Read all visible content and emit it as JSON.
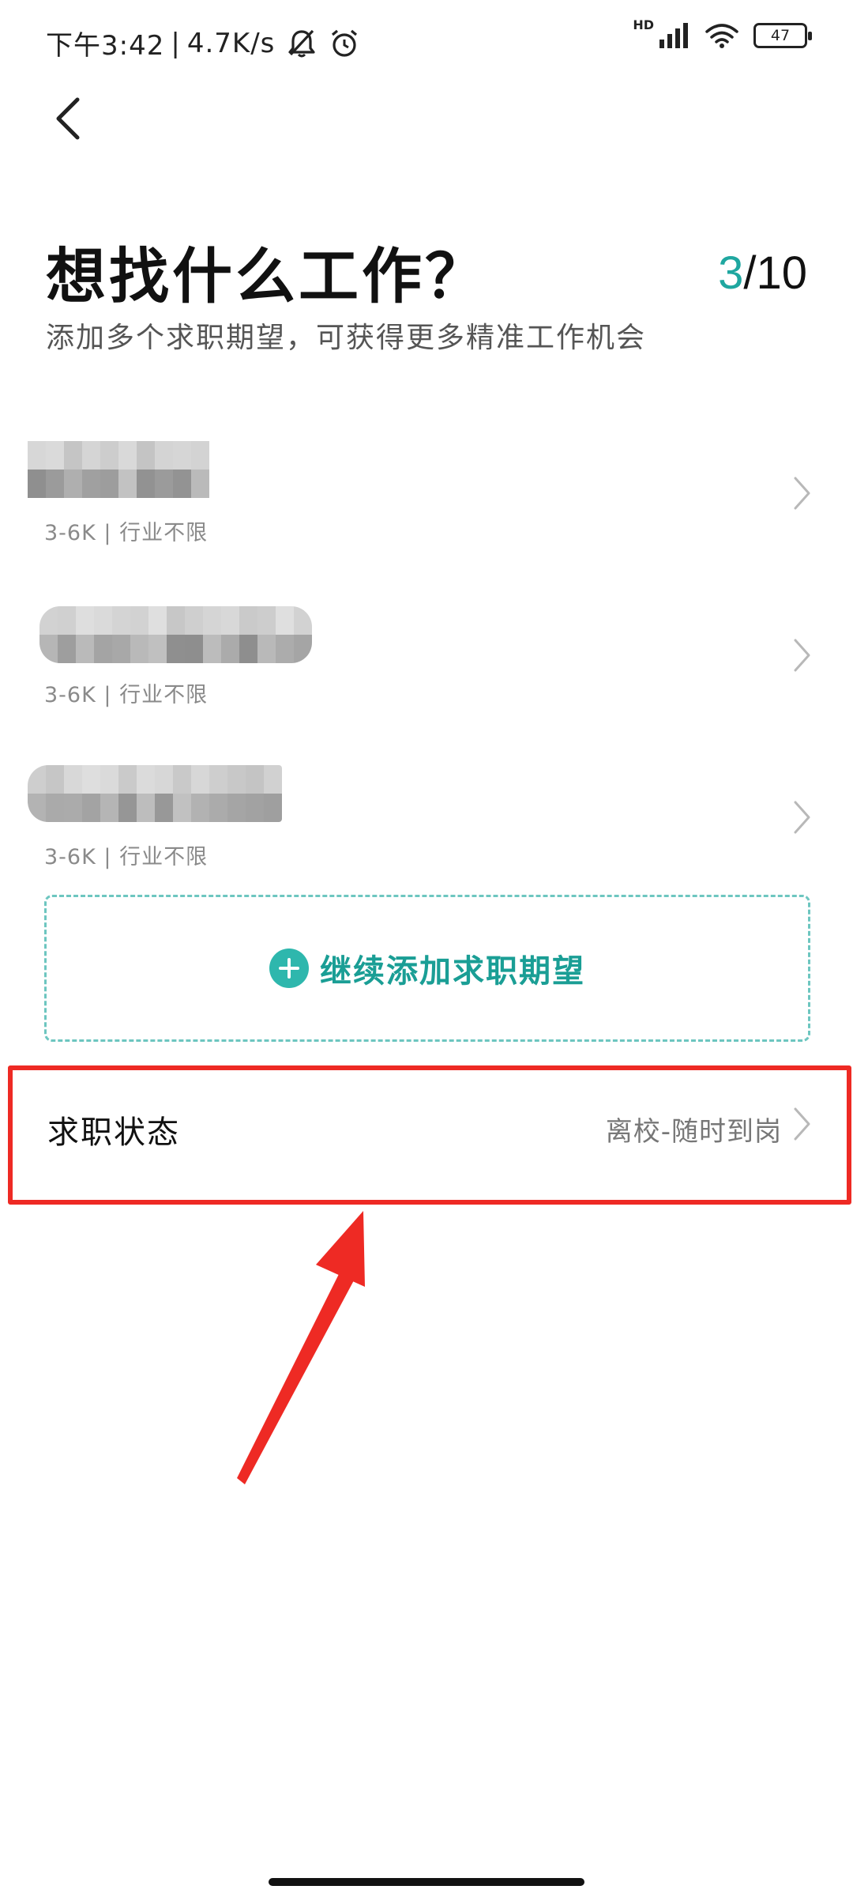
{
  "status_bar": {
    "time": "下午3:42",
    "network_speed": "4.7K/s",
    "hd_label": "HD",
    "battery_level": "47",
    "icons": [
      "bell-off-icon",
      "alarm-clock-icon",
      "signal-icon",
      "wifi-icon",
      "battery-icon"
    ]
  },
  "nav": {
    "back_icon": "chevron-left-icon"
  },
  "header": {
    "title": "想找什么工作？",
    "progress_current": "3",
    "progress_total": "/10",
    "subtitle": "添加多个求职期望，可获得更多精准工作机会"
  },
  "expectations": [
    {
      "title": "",
      "meta": "3-6K | 行业不限",
      "pixelated_title": true,
      "chevron_icon": "chevron-right-icon"
    },
    {
      "title": "",
      "meta": "3-6K | 行业不限",
      "pixelated_title": true,
      "chevron_icon": "chevron-right-icon"
    },
    {
      "title": "",
      "meta": "3-6K | 行业不限",
      "pixelated_title": true,
      "chevron_icon": "chevron-right-icon"
    }
  ],
  "add_expectation": {
    "label": "继续添加求职期望",
    "icon": "plus-circle-icon"
  },
  "job_status": {
    "label": "求职状态",
    "value": "离校-随时到岗",
    "chevron_icon": "chevron-right-icon",
    "highlighted": true
  },
  "colors": {
    "accent": "#1fa7a0",
    "add_border": "#6dc6c0",
    "add_icon": "#2eb7ad",
    "highlight_red": "#ee2a24",
    "meta_gray": "#8a8a8a"
  }
}
